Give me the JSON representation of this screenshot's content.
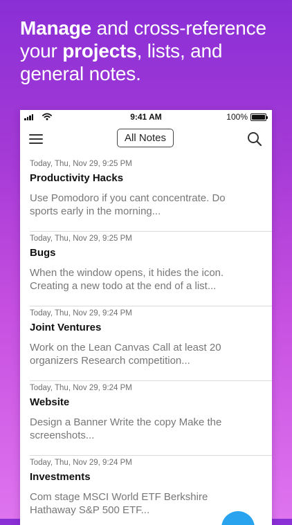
{
  "headline": {
    "part1": "Manage",
    "part2": " and cross-reference your ",
    "part3": "projects",
    "part4": ", lists, and general notes."
  },
  "status_bar": {
    "time": "9:41 AM",
    "battery": "100%"
  },
  "navbar": {
    "title_button": "All Notes",
    "menu_icon": "hamburger-menu-icon",
    "search_icon": "search-icon"
  },
  "notes": [
    {
      "date": "Today, Thu, Nov 29, 9:25 PM",
      "title": "Productivity Hacks",
      "preview": "Use Pomodoro if you cant concentrate. Do sports early in the morning..."
    },
    {
      "date": "Today, Thu, Nov 29, 9:25 PM",
      "title": "Bugs",
      "preview": "When the window opens, it hides the icon. Creating a new todo at the end of a list..."
    },
    {
      "date": "Today, Thu, Nov 29, 9:24 PM",
      "title": "Joint Ventures",
      "preview": "Work on the Lean Canvas Call at least 20 organizers Research competition..."
    },
    {
      "date": "Today, Thu, Nov 29, 9:24 PM",
      "title": "Website",
      "preview": "Design a Banner Write the copy Make the screenshots..."
    },
    {
      "date": "Today, Thu, Nov 29, 9:24 PM",
      "title": "Investments",
      "preview": "Com stage MSCI World ETF Berkshire Hathaway S&P 500 ETF..."
    }
  ],
  "colors": {
    "accent_fab": "#2aa3ef",
    "gradient_top": "#8a2fd6",
    "gradient_bottom": "#de74ee"
  }
}
